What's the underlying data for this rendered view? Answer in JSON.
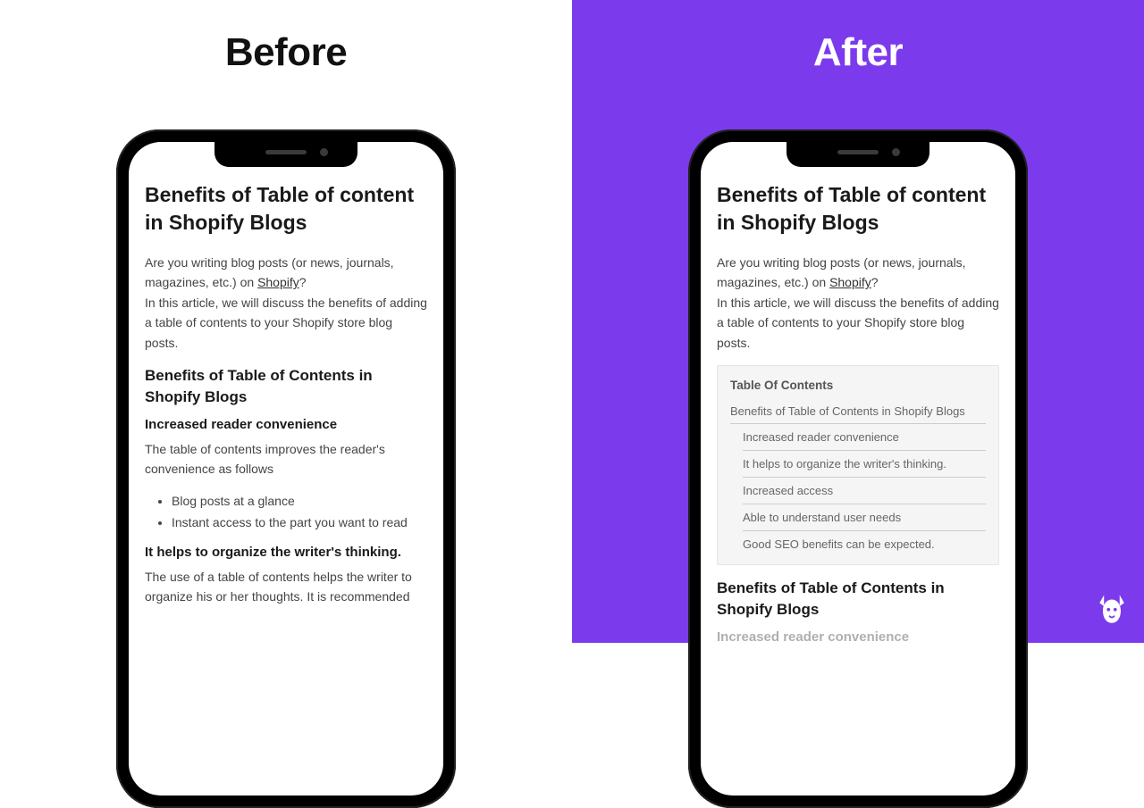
{
  "labels": {
    "before": "Before",
    "after": "After"
  },
  "colors": {
    "right_bg": "#7c3aed",
    "left_bg": "#ffffff"
  },
  "article": {
    "title": "Benefits of Table of content in Shopify Blogs",
    "intro_1_pre": "Are you writing blog posts (or news, journals, magazines, etc.) on ",
    "intro_1_link": "Shopify",
    "intro_1_post": "?",
    "intro_2": "In this article, we will discuss the benefits of adding a table of contents to your Shopify store blog posts.",
    "h2_benefits": "Benefits of Table of Contents in Shopify Blogs",
    "h3_convenience": "Increased reader convenience",
    "p_convenience": "The table of contents improves the reader's convenience as follows",
    "bullets": [
      "Blog posts at a glance",
      "Instant access to the part you want to read"
    ],
    "h3_organize": "It helps to organize the writer's thinking.",
    "p_organize": "The use of a table of contents helps the writer to organize his or her thoughts. It is recommended",
    "h3_cut": "Increased reader convenience"
  },
  "toc": {
    "title": "Table Of Contents",
    "level1": "Benefits of Table of Contents in Shopify Blogs",
    "items": [
      "Increased reader convenience",
      "It helps to organize the writer's thinking.",
      "Increased access",
      "Able to understand user needs",
      "Good SEO benefits can be expected."
    ]
  },
  "brand_icon": "dog-head-icon"
}
